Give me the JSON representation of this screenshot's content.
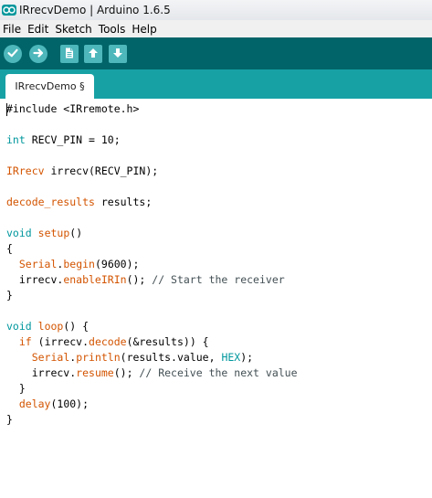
{
  "window": {
    "title": "IRrecvDemo | Arduino 1.6.5"
  },
  "menu": [
    "File",
    "Edit",
    "Sketch",
    "Tools",
    "Help"
  ],
  "toolbar": {
    "buttons": [
      {
        "name": "verify",
        "icon": "checkmark-icon"
      },
      {
        "name": "upload",
        "icon": "right-arrow-icon"
      },
      {
        "name": "new",
        "icon": "new-file-icon"
      },
      {
        "name": "open",
        "icon": "up-arrow-icon"
      },
      {
        "name": "save",
        "icon": "down-arrow-icon"
      }
    ]
  },
  "tabs": [
    {
      "label": "IRrecvDemo §",
      "active": true
    }
  ],
  "colors": {
    "toolbar_bg": "#006468",
    "tabbar_bg": "#17a1a5",
    "button_bg": "#4db7bb",
    "keyword_type": "#00979d",
    "keyword_func": "#d35400",
    "comment": "#434f54"
  },
  "editor": {
    "lines": [
      [
        {
          "t": "#include <IRremote.h>"
        }
      ],
      [],
      [
        {
          "t": "int",
          "c": "type"
        },
        {
          "t": " RECV_PIN = 10;"
        }
      ],
      [],
      [
        {
          "t": "IRrecv",
          "c": "func"
        },
        {
          "t": " irrecv(RECV_PIN);"
        }
      ],
      [],
      [
        {
          "t": "decode_results",
          "c": "func"
        },
        {
          "t": " results;"
        }
      ],
      [],
      [
        {
          "t": "void",
          "c": "type"
        },
        {
          "t": " "
        },
        {
          "t": "setup",
          "c": "func"
        },
        {
          "t": "()"
        }
      ],
      [
        {
          "t": "{"
        }
      ],
      [
        {
          "t": "  "
        },
        {
          "t": "Serial",
          "c": "func"
        },
        {
          "t": "."
        },
        {
          "t": "begin",
          "c": "func"
        },
        {
          "t": "(9600);"
        }
      ],
      [
        {
          "t": "  irrecv."
        },
        {
          "t": "enableIRIn",
          "c": "func"
        },
        {
          "t": "(); "
        },
        {
          "t": "// Start the receiver",
          "c": "comment"
        }
      ],
      [
        {
          "t": "}"
        }
      ],
      [],
      [
        {
          "t": "void",
          "c": "type"
        },
        {
          "t": " "
        },
        {
          "t": "loop",
          "c": "func"
        },
        {
          "t": "() {"
        }
      ],
      [
        {
          "t": "  "
        },
        {
          "t": "if",
          "c": "func"
        },
        {
          "t": " (irrecv."
        },
        {
          "t": "decode",
          "c": "func"
        },
        {
          "t": "(&results)) {"
        }
      ],
      [
        {
          "t": "    "
        },
        {
          "t": "Serial",
          "c": "func"
        },
        {
          "t": "."
        },
        {
          "t": "println",
          "c": "func"
        },
        {
          "t": "(results.value, "
        },
        {
          "t": "HEX",
          "c": "type"
        },
        {
          "t": ");"
        }
      ],
      [
        {
          "t": "    irrecv."
        },
        {
          "t": "resume",
          "c": "func"
        },
        {
          "t": "(); "
        },
        {
          "t": "// Receive the next value",
          "c": "comment"
        }
      ],
      [
        {
          "t": "  }"
        }
      ],
      [
        {
          "t": "  "
        },
        {
          "t": "delay",
          "c": "func"
        },
        {
          "t": "(100);"
        }
      ],
      [
        {
          "t": "}"
        }
      ]
    ]
  }
}
